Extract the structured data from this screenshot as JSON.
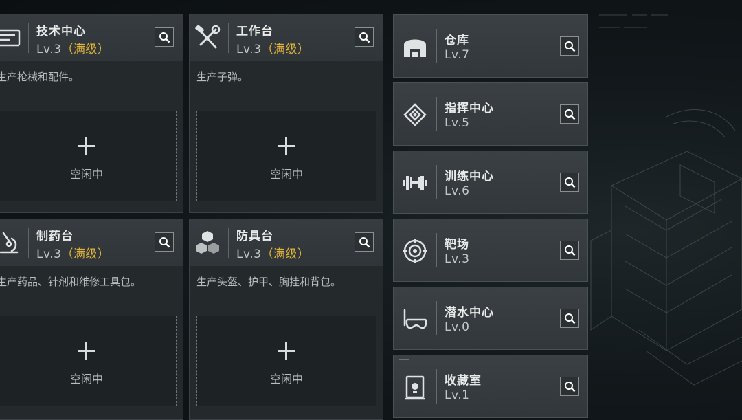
{
  "idle_label": "空闲中",
  "colors": {
    "maxed": "#e0b43a",
    "panel": "#24292c"
  },
  "cards": [
    {
      "title": "技术中心",
      "level": "Lv.3",
      "maxed": "（满级）",
      "desc": "生产枪械和配件。",
      "icon": "tech-center-icon"
    },
    {
      "title": "工作台",
      "level": "Lv.3",
      "maxed": "（满级）",
      "desc": "生产子弹。",
      "icon": "hammer-wrench-icon"
    },
    {
      "title": "制药台",
      "level": "Lv.3",
      "maxed": "（满级）",
      "desc": "生产药品、针剂和维修工具包。",
      "icon": "microscope-icon"
    },
    {
      "title": "防具台",
      "level": "Lv.3",
      "maxed": "（满级）",
      "desc": "生产头盔、护甲、胸挂和背包。",
      "icon": "cubes-icon"
    }
  ],
  "facilities": [
    {
      "title": "仓库",
      "level": "Lv.7",
      "icon": "warehouse-icon"
    },
    {
      "title": "指挥中心",
      "level": "Lv.5",
      "icon": "chip-icon"
    },
    {
      "title": "训练中心",
      "level": "Lv.6",
      "icon": "dumbbell-icon"
    },
    {
      "title": "靶场",
      "level": "Lv.3",
      "icon": "target-icon"
    },
    {
      "title": "潜水中心",
      "level": "Lv.0",
      "icon": "diving-mask-icon"
    },
    {
      "title": "收藏室",
      "level": "Lv.1",
      "icon": "trophy-case-icon"
    }
  ]
}
